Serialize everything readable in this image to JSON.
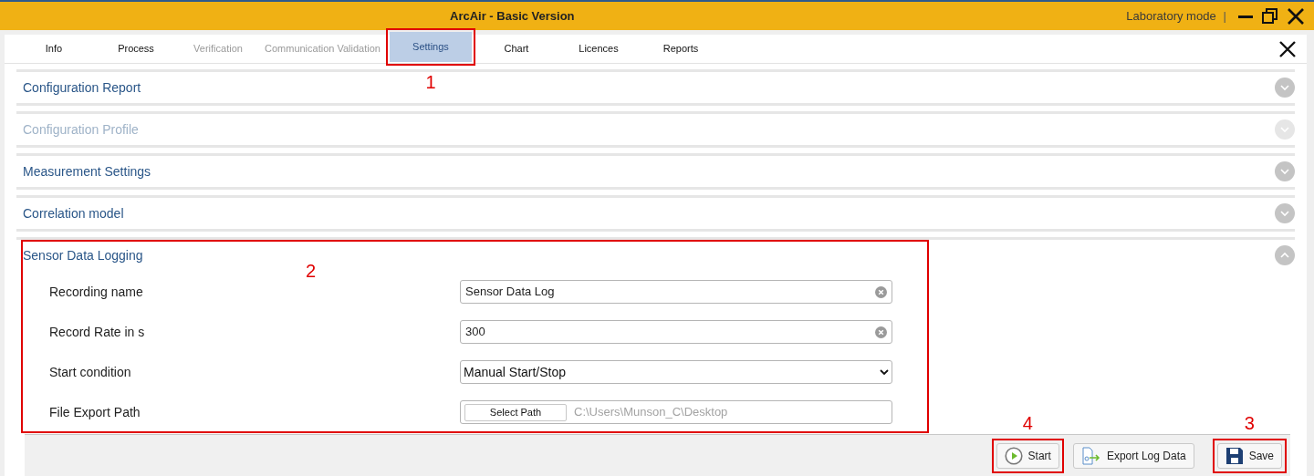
{
  "window": {
    "title": "ArcAir - Basic Version",
    "mode": "Laboratory mode",
    "separator": "|"
  },
  "tabs": [
    {
      "label": "Info",
      "selected": false,
      "disabled": false
    },
    {
      "label": "Process",
      "selected": false,
      "disabled": false
    },
    {
      "label": "Verification",
      "selected": false,
      "disabled": true
    },
    {
      "label": "Communication Validation",
      "selected": false,
      "disabled": true
    },
    {
      "label": "Settings",
      "selected": true,
      "disabled": false,
      "callout": "1"
    },
    {
      "label": "Chart",
      "selected": false,
      "disabled": false
    },
    {
      "label": "Licences",
      "selected": false,
      "disabled": false
    },
    {
      "label": "Reports",
      "selected": false,
      "disabled": false
    }
  ],
  "sections": [
    {
      "title": "Configuration Report",
      "expanded": false,
      "disabled": false
    },
    {
      "title": "Configuration Profile",
      "expanded": false,
      "disabled": true
    },
    {
      "title": "Measurement Settings",
      "expanded": false,
      "disabled": false
    },
    {
      "title": "Correlation model",
      "expanded": false,
      "disabled": false
    },
    {
      "title": "Sensor Data Logging",
      "expanded": true,
      "disabled": false,
      "callout": "2",
      "fields": [
        {
          "kind": "text",
          "label": "Recording name",
          "value": "Sensor Data Log"
        },
        {
          "kind": "text",
          "label": "Record Rate in s",
          "value": "300"
        },
        {
          "kind": "select",
          "label": "Start condition",
          "value": "Manual Start/Stop"
        },
        {
          "kind": "path",
          "label": "File Export Path",
          "button": "Select Path",
          "placeholder": "C:\\Users\\Munson_C\\Desktop"
        }
      ]
    }
  ],
  "footer_buttons": [
    {
      "kind": "start",
      "label": "Start",
      "callout": "4"
    },
    {
      "kind": "export",
      "label": "Export Log Data"
    },
    {
      "kind": "save",
      "label": "Save",
      "callout": "3"
    }
  ]
}
